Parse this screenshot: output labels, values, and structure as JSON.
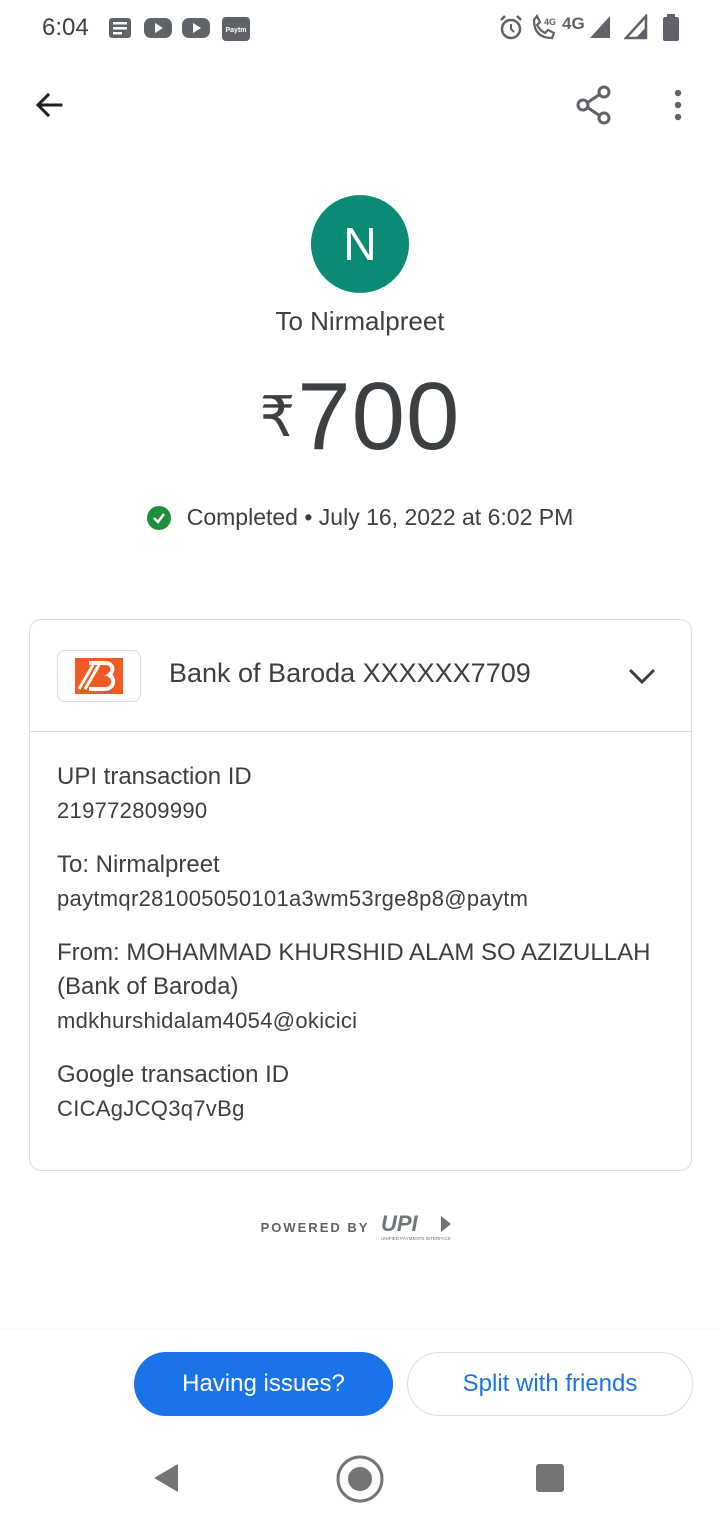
{
  "status_bar": {
    "time": "6:04",
    "left_icons": [
      "news-icon",
      "youtube-icon",
      "youtube-icon",
      "paytm-icon"
    ],
    "paytm_label": "Paytm",
    "network_label": "4G",
    "volte_label": "4G"
  },
  "app_bar": {
    "back_icon": "arrow-back-icon",
    "share_icon": "share-icon",
    "more_icon": "more-vert-icon"
  },
  "header": {
    "avatar_letter": "N",
    "avatar_color": "#0b8b74",
    "recipient": "To Nirmalpreet",
    "currency": "₹",
    "amount": "700",
    "status": "Completed • July 16, 2022 at 6:02 PM",
    "status_color": "#1e8e3e"
  },
  "card": {
    "bank_name": "Bank of Baroda XXXXXX7709",
    "bank_logo_color": "#f15a22",
    "details": [
      {
        "label": "UPI transaction ID",
        "values": [
          "219772809990"
        ]
      },
      {
        "label": "To: Nirmalpreet",
        "values": [
          "paytmqr281005050101a3wm53rge8p8@paytm"
        ]
      },
      {
        "label": "From: MOHAMMAD KHURSHID ALAM SO AZIZULLAH (Bank of Baroda)",
        "values": [
          "mdkhurshidalam4054@okicici"
        ]
      },
      {
        "label": "Google transaction ID",
        "values": [
          "CICAgJCQ3q7vBg"
        ]
      }
    ]
  },
  "powered_by": {
    "text": "POWERED BY",
    "logo_text": "UPI",
    "logo_subtext": "UNIFIED PAYMENTS INTERFACE"
  },
  "actions": {
    "issues_label": "Having issues?",
    "split_label": "Split with friends",
    "accent": "#1a73e8"
  }
}
